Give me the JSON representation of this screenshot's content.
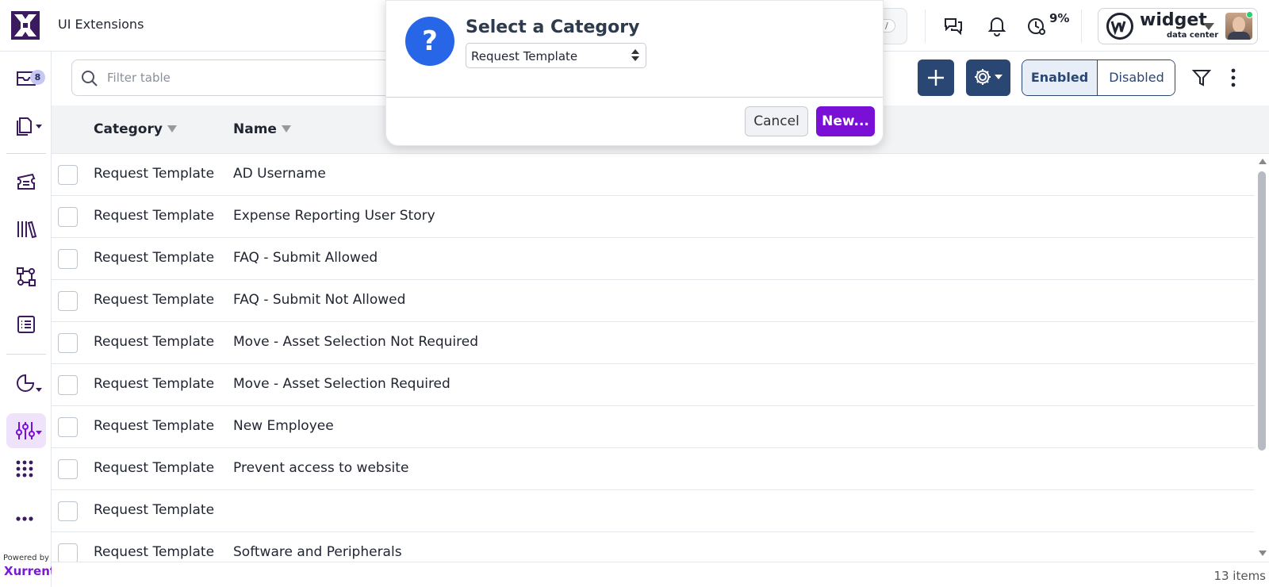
{
  "app": {
    "title": "UI Extensions",
    "kbd_hint": "/"
  },
  "header": {
    "timer_percent": "9%",
    "brand": {
      "name": "widget",
      "sub": "data center"
    }
  },
  "sidebar": {
    "inbox_badge": "8",
    "powered_by": "Powered by",
    "vendor": "Xurrent"
  },
  "toolbar": {
    "filter_placeholder": "Filter table",
    "enabled_label": "Enabled",
    "disabled_label": "Disabled"
  },
  "table": {
    "columns": [
      "Category",
      "Name"
    ],
    "rows": [
      {
        "category": "Request Template",
        "name": "AD Username"
      },
      {
        "category": "Request Template",
        "name": "Expense Reporting User Story"
      },
      {
        "category": "Request Template",
        "name": "FAQ - Submit Allowed"
      },
      {
        "category": "Request Template",
        "name": "FAQ - Submit Not Allowed"
      },
      {
        "category": "Request Template",
        "name": "Move - Asset Selection Not Required"
      },
      {
        "category": "Request Template",
        "name": "Move - Asset Selection Required"
      },
      {
        "category": "Request Template",
        "name": "New Employee"
      },
      {
        "category": "Request Template",
        "name": "Prevent access to website"
      },
      {
        "category": "Request Template",
        "name": ""
      },
      {
        "category": "Request Template",
        "name": "Software and Peripherals"
      }
    ],
    "item_count": "13 items"
  },
  "dialog": {
    "title": "Select a Category",
    "icon_glyph": "?",
    "selected_category": "Request Template",
    "cancel_label": "Cancel",
    "new_label": "New..."
  },
  "colors": {
    "primary_navy": "#2a4672",
    "accent_purple": "#7a0fd6",
    "dialog_icon_blue": "#2866e8",
    "active_nav_bg": "#efe3fb"
  }
}
